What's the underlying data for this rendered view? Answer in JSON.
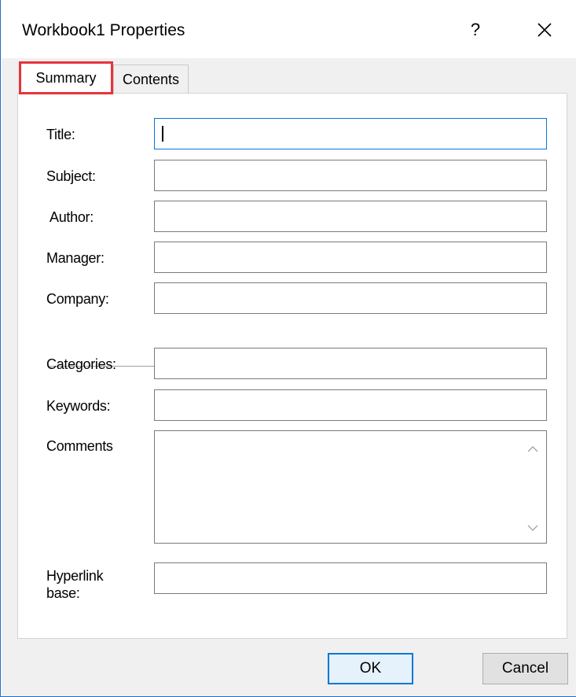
{
  "window": {
    "title": "Workbook1 Properties",
    "help_label": "?",
    "close_icon": "close-icon"
  },
  "tabs": [
    {
      "label": "Summary",
      "selected": true
    },
    {
      "label": "Contents",
      "selected": false
    }
  ],
  "fields": {
    "title": {
      "label": "Title:",
      "value": ""
    },
    "subject": {
      "label": "Subject:",
      "value": ""
    },
    "author": {
      "label": "Author:",
      "value": ""
    },
    "manager": {
      "label": "Manager:",
      "value": ""
    },
    "company": {
      "label": "Company:",
      "value": ""
    },
    "categories": {
      "label": "Categories:",
      "value": ""
    },
    "keywords": {
      "label": "Keywords:",
      "value": ""
    },
    "comments": {
      "label": "Comments",
      "value": ""
    },
    "hyperlink_base": {
      "label_line1": "Hyperlink",
      "label_line2": "base:",
      "value": ""
    }
  },
  "buttons": {
    "ok": "OK",
    "cancel": "Cancel"
  },
  "colors": {
    "focus_border": "#0a74da",
    "highlight_box": "#e8333b",
    "window_border": "#1f6fc5"
  }
}
